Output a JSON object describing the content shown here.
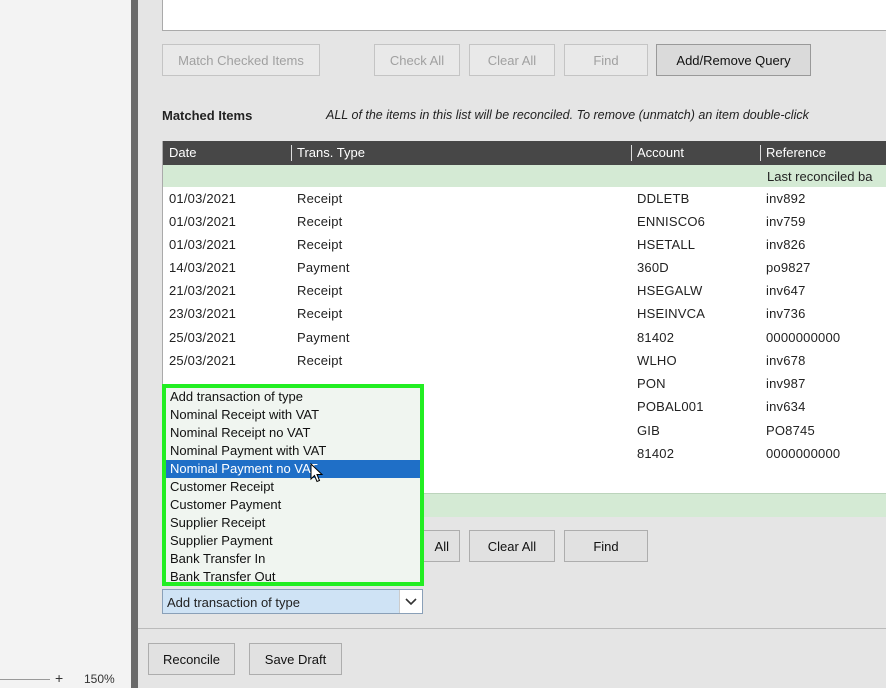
{
  "zoom": {
    "level": "150%",
    "plus": "+"
  },
  "toolbar": {
    "match_checked": "Match Checked Items",
    "check_all": "Check All",
    "clear_all": "Clear All",
    "find": "Find",
    "add_remove_query": "Add/Remove Query"
  },
  "matched": {
    "title": "Matched Items",
    "note": "ALL of the items in this list will be reconciled. To remove (unmatch) an item double-click",
    "columns": {
      "date": "Date",
      "type": "Trans. Type",
      "account": "Account",
      "reference": "Reference"
    },
    "last_reconciled": "Last reconciled ba",
    "rows": [
      {
        "date": "01/03/2021",
        "type": "Receipt",
        "account": "DDLETB",
        "ref": "inv892"
      },
      {
        "date": "01/03/2021",
        "type": "Receipt",
        "account": "ENNISCO6",
        "ref": "inv759"
      },
      {
        "date": "01/03/2021",
        "type": "Receipt",
        "account": "HSETALL",
        "ref": "inv826"
      },
      {
        "date": "14/03/2021",
        "type": "Payment",
        "account": "360D",
        "ref": "po9827"
      },
      {
        "date": "21/03/2021",
        "type": "Receipt",
        "account": "HSEGALW",
        "ref": "inv647"
      },
      {
        "date": "23/03/2021",
        "type": "Receipt",
        "account": "HSEINVCA",
        "ref": "inv736"
      },
      {
        "date": "25/03/2021",
        "type": "Payment",
        "account": "81402",
        "ref": "0000000000"
      },
      {
        "date": "25/03/2021",
        "type": "Receipt",
        "account": "WLHO",
        "ref": "inv678"
      },
      {
        "date": "",
        "type": "",
        "account": "PON",
        "ref": "inv987"
      },
      {
        "date": "",
        "type": "",
        "account": "POBAL001",
        "ref": "inv634"
      },
      {
        "date": "",
        "type": "",
        "account": "GIB",
        "ref": "PO8745"
      },
      {
        "date": "",
        "type": "",
        "account": "81402",
        "ref": "0000000000"
      }
    ]
  },
  "lower_buttons": {
    "check_all_partial": "All",
    "clear_all": "Clear All",
    "find": "Find"
  },
  "dropdown": {
    "options": [
      "Add transaction of type",
      "Nominal Receipt with VAT",
      "Nominal Receipt no VAT",
      "Nominal Payment with VAT",
      "Nominal Payment no VAT",
      "Customer Receipt",
      "Customer Payment",
      "Supplier Receipt",
      "Supplier Payment",
      "Bank Transfer In",
      "Bank Transfer Out"
    ],
    "selected_index": 4,
    "highlight_color": "#22ee22",
    "selection_color": "#1f6fc7"
  },
  "combo": {
    "value": "Add transaction of type"
  },
  "footer": {
    "reconcile": "Reconcile",
    "save_draft": "Save Draft"
  },
  "icons": {
    "dropdown_arrow": "chevron-down-icon",
    "cursor": "mouse-pointer-icon"
  }
}
